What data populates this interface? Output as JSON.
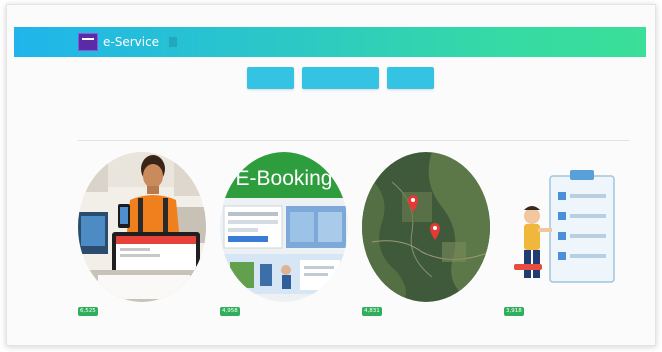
{
  "navbar": {
    "brand": "e-Service"
  },
  "section": {
    "title": ""
  },
  "cards": [
    {
      "overlay_text": "",
      "icon": "person-tablet-photo",
      "badge": "6,525"
    },
    {
      "overlay_text": "E-Booking",
      "icon": "booking-screenshot",
      "badge": "4,958"
    },
    {
      "overlay_text": "",
      "icon": "map-pin-icon",
      "badge": "4,831"
    },
    {
      "overlay_text": "",
      "icon": "checklist-clipboard-icon",
      "badge": "3,918"
    }
  ],
  "colors": {
    "nav_start": "#1fb5ec",
    "nav_end": "#3adf98",
    "button": "#35c3e4",
    "link": "#3a6fc8",
    "badge": "#2fae5b"
  }
}
